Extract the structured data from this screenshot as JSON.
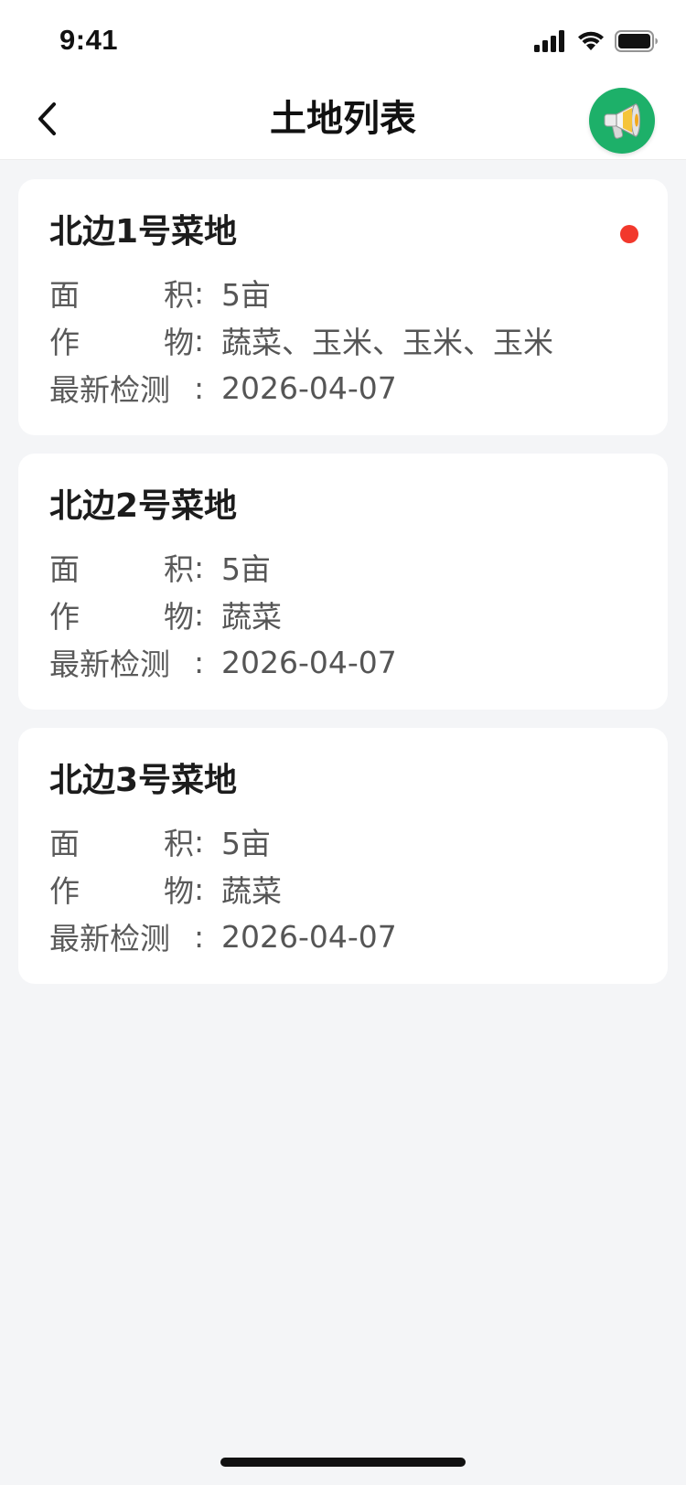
{
  "status": {
    "time": "9:41"
  },
  "nav": {
    "title": "土地列表"
  },
  "labels": {
    "area_c1": "面",
    "area_c2": "积",
    "crop_c1": "作",
    "crop_c2": "物",
    "detect": "最新检测",
    "colon": ":"
  },
  "cards": [
    {
      "title": "北边1号菜地",
      "area": "5亩",
      "crops": "蔬菜、玉米、玉米、玉米",
      "detected": "2026-04-07",
      "unread": true
    },
    {
      "title": "北边2号菜地",
      "area": "5亩",
      "crops": "蔬菜",
      "detected": "2026-04-07",
      "unread": false
    },
    {
      "title": "北边3号菜地",
      "area": "5亩",
      "crops": "蔬菜",
      "detected": "2026-04-07",
      "unread": false
    }
  ],
  "colors": {
    "accent": "#1db069",
    "alert": "#f2382c",
    "background": "#f4f5f7"
  },
  "icons": [
    "back-chevron-icon",
    "megaphone-icon",
    "signal-icon",
    "wifi-icon",
    "battery-icon"
  ]
}
